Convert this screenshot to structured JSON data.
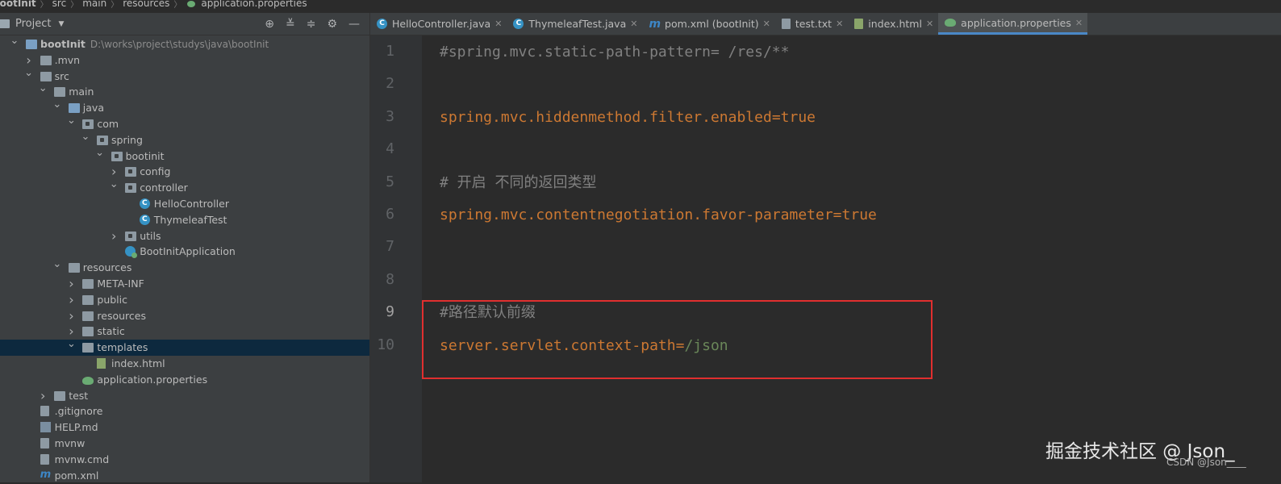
{
  "breadcrumb": [
    "bootInit",
    "src",
    "main",
    "resources",
    "application.properties"
  ],
  "project_panel": {
    "title": "Project",
    "tools": [
      "target-icon",
      "expand-all-icon",
      "collapse-all-icon",
      "gear-icon",
      "hide-icon"
    ]
  },
  "tree": [
    {
      "label": "bootInit",
      "path": "D:\\works\\project\\studys\\java\\bootInit",
      "depth": 0,
      "arrow": "down",
      "icon": "module"
    },
    {
      "label": ".mvn",
      "depth": 1,
      "arrow": "right",
      "icon": "folder"
    },
    {
      "label": "src",
      "depth": 1,
      "arrow": "down",
      "icon": "folder"
    },
    {
      "label": "main",
      "depth": 2,
      "arrow": "down",
      "icon": "folder"
    },
    {
      "label": "java",
      "depth": 3,
      "arrow": "down",
      "icon": "source-folder"
    },
    {
      "label": "com",
      "depth": 4,
      "arrow": "down",
      "icon": "package"
    },
    {
      "label": "spring",
      "depth": 5,
      "arrow": "down",
      "icon": "package"
    },
    {
      "label": "bootinit",
      "depth": 6,
      "arrow": "down",
      "icon": "package"
    },
    {
      "label": "config",
      "depth": 7,
      "arrow": "right",
      "icon": "package"
    },
    {
      "label": "controller",
      "depth": 7,
      "arrow": "down",
      "icon": "package"
    },
    {
      "label": "HelloController",
      "depth": 8,
      "arrow": "",
      "icon": "class"
    },
    {
      "label": "ThymeleafTest",
      "depth": 8,
      "arrow": "",
      "icon": "class"
    },
    {
      "label": "utils",
      "depth": 7,
      "arrow": "right",
      "icon": "package"
    },
    {
      "label": "BootInitApplication",
      "depth": 7,
      "arrow": "",
      "icon": "spring-app"
    },
    {
      "label": "resources",
      "depth": 3,
      "arrow": "down",
      "icon": "resources-folder"
    },
    {
      "label": "META-INF",
      "depth": 4,
      "arrow": "right",
      "icon": "folder"
    },
    {
      "label": "public",
      "depth": 4,
      "arrow": "right",
      "icon": "folder"
    },
    {
      "label": "resources",
      "depth": 4,
      "arrow": "right",
      "icon": "folder"
    },
    {
      "label": "static",
      "depth": 4,
      "arrow": "right",
      "icon": "folder"
    },
    {
      "label": "templates",
      "depth": 4,
      "arrow": "down",
      "icon": "folder",
      "selected": true
    },
    {
      "label": "index.html",
      "depth": 5,
      "arrow": "",
      "icon": "html"
    },
    {
      "label": "application.properties",
      "depth": 4,
      "arrow": "",
      "icon": "properties"
    },
    {
      "label": "test",
      "depth": 2,
      "arrow": "right",
      "icon": "folder"
    },
    {
      "label": ".gitignore",
      "depth": 1,
      "arrow": "",
      "icon": "file"
    },
    {
      "label": "HELP.md",
      "depth": 1,
      "arrow": "",
      "icon": "markdown"
    },
    {
      "label": "mvnw",
      "depth": 1,
      "arrow": "",
      "icon": "file"
    },
    {
      "label": "mvnw.cmd",
      "depth": 1,
      "arrow": "",
      "icon": "file"
    },
    {
      "label": "pom.xml",
      "depth": 1,
      "arrow": "",
      "icon": "maven"
    }
  ],
  "tabs": [
    {
      "label": "HelloController.java",
      "icon": "class",
      "active": false
    },
    {
      "label": "ThymeleafTest.java",
      "icon": "class",
      "active": false
    },
    {
      "label": "pom.xml (bootInit)",
      "icon": "maven",
      "active": false
    },
    {
      "label": "test.txt",
      "icon": "text",
      "active": false
    },
    {
      "label": "index.html",
      "icon": "html",
      "active": false
    },
    {
      "label": "application.properties",
      "icon": "properties",
      "active": true
    }
  ],
  "editor": {
    "line_numbers": [
      "1",
      "2",
      "3",
      "4",
      "5",
      "6",
      "7",
      "8",
      "9",
      "10"
    ],
    "current_line": "9",
    "lines": [
      {
        "n": "1",
        "parts": [
          {
            "t": "#spring.mvc.static-path-pattern= /res/**",
            "c": "cm"
          }
        ]
      },
      {
        "n": "2",
        "parts": []
      },
      {
        "n": "3",
        "parts": [
          {
            "t": "spring.mvc.hiddenmethod.filter.enabled",
            "c": "k"
          },
          {
            "t": "=",
            "c": "eq"
          },
          {
            "t": "true",
            "c": "v"
          }
        ]
      },
      {
        "n": "4",
        "parts": []
      },
      {
        "n": "5",
        "parts": [
          {
            "t": "# 开启 不同的返回类型",
            "c": "cm"
          }
        ]
      },
      {
        "n": "6",
        "parts": [
          {
            "t": "spring.mvc.contentnegotiation.favor-parameter",
            "c": "k"
          },
          {
            "t": "=",
            "c": "eq"
          },
          {
            "t": "true",
            "c": "v"
          }
        ]
      },
      {
        "n": "7",
        "parts": []
      },
      {
        "n": "8",
        "parts": []
      },
      {
        "n": "9",
        "parts": [
          {
            "t": "#路径默认前缀",
            "c": "cm"
          }
        ]
      },
      {
        "n": "10",
        "parts": [
          {
            "t": "server.servlet.context-path",
            "c": "k"
          },
          {
            "t": "=",
            "c": "eq"
          },
          {
            "t": "/json",
            "c": "s"
          }
        ]
      }
    ]
  },
  "watermark": {
    "main": "掘金技术社区 @ Json_",
    "small": "CSDN @Json____"
  },
  "colors": {
    "key": "#cc7832",
    "string": "#6a8759",
    "comment": "#808080",
    "highlight_border": "#e02f2f",
    "selection": "#0d293e",
    "active_tab_underline": "#4a88c7"
  }
}
